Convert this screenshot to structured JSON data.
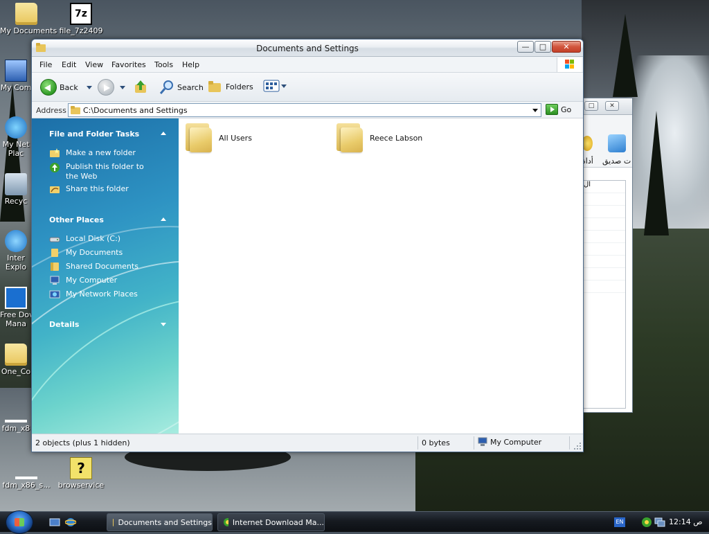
{
  "desktop": {
    "icons": [
      {
        "label": "My Documents"
      },
      {
        "label": "file_7z2409"
      },
      {
        "label": "My Com"
      },
      {
        "label": "My Net"
      },
      {
        "label": "Plac"
      },
      {
        "label": "Recyc"
      },
      {
        "label": "Inter"
      },
      {
        "label": "Explo"
      },
      {
        "label": "Free Dov"
      },
      {
        "label": "Mana"
      },
      {
        "label": "One_Co"
      },
      {
        "label": "fdm_x8"
      },
      {
        "label": "fdm_x86_s..."
      },
      {
        "label": "browservice"
      }
    ],
    "seven_zip_badge": "7z"
  },
  "background_window": {
    "toolbar_labels": [
      "أداة",
      "ت صديق"
    ],
    "list_header": "ال",
    "restore_label": "□",
    "close_label": "✕"
  },
  "window": {
    "title": "Documents and Settings",
    "buttons": {
      "minimize": "—",
      "maximize": "□",
      "close": "✕"
    },
    "menu": [
      "File",
      "Edit",
      "View",
      "Favorites",
      "Tools",
      "Help"
    ],
    "toolbar": {
      "back": "Back",
      "search": "Search",
      "folders": "Folders"
    },
    "address": {
      "label": "Address",
      "value": "C:\\Documents and Settings",
      "go": "Go"
    },
    "task_pane": {
      "file_folder_tasks": {
        "header": "File and Folder Tasks",
        "items": [
          "Make a new folder",
          "Publish this folder to the Web",
          "Share this folder"
        ]
      },
      "other_places": {
        "header": "Other Places",
        "items": [
          "Local Disk (C:)",
          "My Documents",
          "Shared Documents",
          "My Computer",
          "My Network Places"
        ]
      },
      "details": {
        "header": "Details"
      }
    },
    "files": [
      {
        "name": "All Users"
      },
      {
        "name": "Reece Labson"
      }
    ],
    "status": {
      "objects": "2 objects (plus 1 hidden)",
      "size": "0 bytes",
      "location": "My Computer"
    }
  },
  "taskbar": {
    "tasks": [
      {
        "label": "Documents and Settings",
        "active": true
      },
      {
        "label": "Internet Download Ma...",
        "active": false
      }
    ],
    "language": "EN",
    "clock": "12:14 ص"
  }
}
